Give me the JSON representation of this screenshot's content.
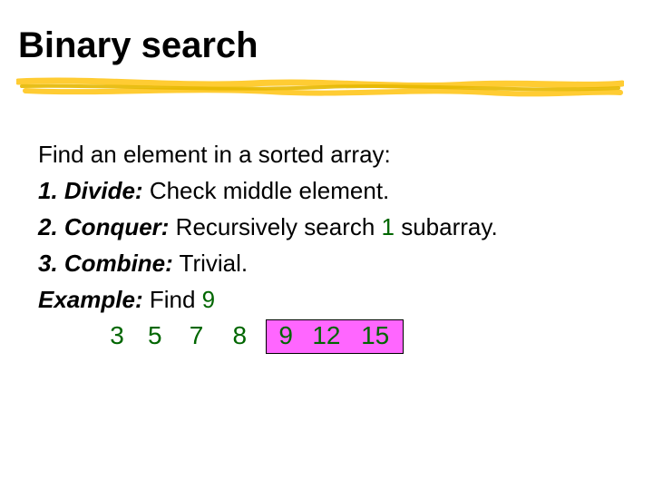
{
  "title": "Binary search",
  "intro": "Find an element in a sorted array:",
  "steps": [
    {
      "label": "1. Divide:",
      "text": " Check middle element."
    },
    {
      "label": "2. Conquer:",
      "text_before": " Recursively search ",
      "emph": "1",
      "text_after": " subarray."
    },
    {
      "label": "3. Combine:",
      "text": " Trivial."
    }
  ],
  "example_label": "Example:",
  "example_text_before": " Find ",
  "example_target": "9",
  "array": {
    "unhighlighted": [
      "3",
      "5",
      "7",
      "8"
    ],
    "highlighted": [
      "9",
      "12",
      "15"
    ]
  }
}
